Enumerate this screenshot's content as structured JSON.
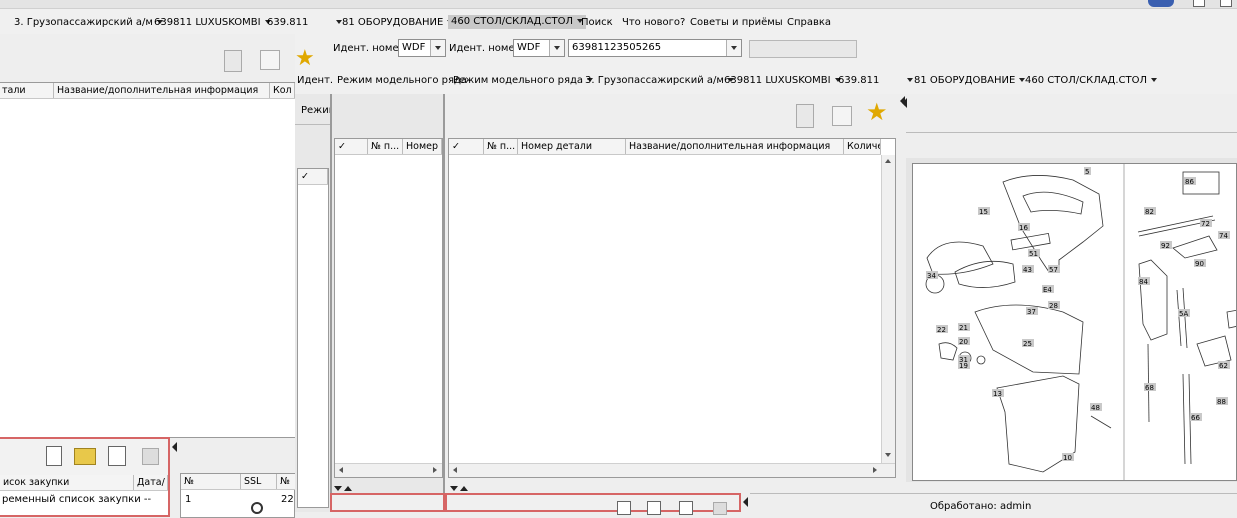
{
  "nav_top": [
    {
      "label": "3. Грузопассажирский а/м",
      "dropdown": true
    },
    {
      "label": "639811 LUXUSKOMBI",
      "dropdown": true
    },
    {
      "label": "639.811",
      "dropdown": true
    },
    {
      "label": "81 ОБОРУДОВАНИЕ",
      "dropdown": true
    },
    {
      "label": "460 СТОЛ/СКЛАД.СТОЛ",
      "dropdown": true
    },
    {
      "label": "Поиск",
      "dropdown": false
    },
    {
      "label": "Что нового?",
      "dropdown": false
    },
    {
      "label": "Советы и приёмы",
      "dropdown": false
    },
    {
      "label": "Справка",
      "dropdown": false
    }
  ],
  "ident": {
    "label1": "Идент. номер",
    "value1": "WDF",
    "label2": "Идент. номер",
    "value2": "WDF",
    "vin": "63981123505265",
    "side_label": "Идент."
  },
  "nav_second": [
    {
      "label": "Режим модельного ряда",
      "dropdown": false
    },
    {
      "label": "Режим модельного ряда",
      "dropdown": true
    },
    {
      "label": "3. Грузопассажирский а/м",
      "dropdown": true
    },
    {
      "label": "639811 LUXUSKOMBI",
      "dropdown": true
    },
    {
      "label": "639.811",
      "dropdown": true
    },
    {
      "label": "81 ОБОРУДОВАНИЕ",
      "dropdown": true
    },
    {
      "label": "460 СТОЛ/СКЛАД.СТОЛ",
      "dropdown": true
    }
  ],
  "left_table": {
    "col1": "тали",
    "col2": "Название/дополнительная информация",
    "col3": "Кол"
  },
  "mode_label": "Режим",
  "check_mark": "✓",
  "mid_table": {
    "col_check": "✓",
    "col_pos": "№ п...",
    "col_num": "Номер дет"
  },
  "main_table": {
    "col_check": "✓",
    "col_pos": "№ п...",
    "col_num": "Номер детали",
    "col_name": "Название/дополнительная информация",
    "col_qty": "Количес"
  },
  "purchase_table": {
    "col1": "исок закупки",
    "col2": "Дата/",
    "row1": "ременный список закупки --"
  },
  "ssl_table": {
    "col1": "№",
    "col2": "SSL",
    "col3": "№",
    "row_num": "1",
    "row_val": "22"
  },
  "status": {
    "processed": "Обработано: admin"
  },
  "diagram_labels": [
    "5",
    "15",
    "16",
    "51",
    "43",
    "57",
    "34",
    "E4",
    "37",
    "28",
    "22",
    "21",
    "25",
    "20",
    "19",
    "31",
    "13",
    "48",
    "10",
    "86",
    "82",
    "72",
    "74",
    "92",
    "90",
    "84",
    "5A",
    "62",
    "68",
    "66",
    "88"
  ],
  "colors": {
    "highlight_border": "#d66565",
    "selected_nav_bg": "#c8c8c8"
  }
}
